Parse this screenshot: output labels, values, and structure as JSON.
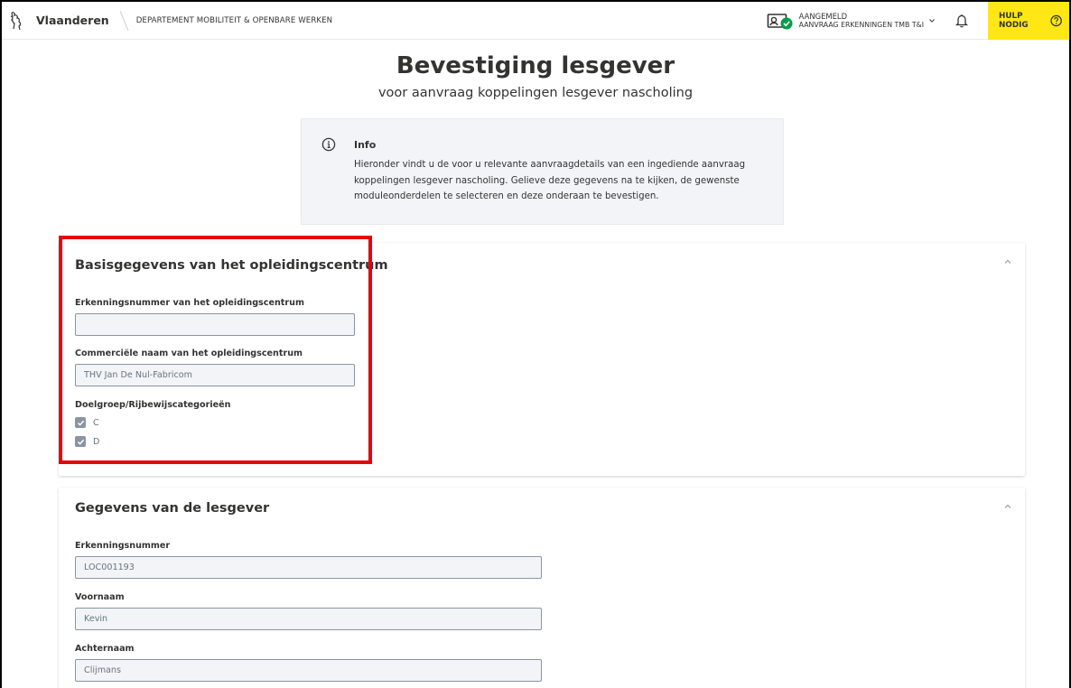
{
  "header": {
    "brand": "Vlaanderen",
    "department": "DEPARTEMENT MOBILITEIT & OPENBARE WERKEN",
    "user_status": "AANGEMELD",
    "user_role": "AANVRAAG ERKENNINGEN TMB T&I",
    "help_label": "HULP NODIG"
  },
  "page": {
    "title": "Bevestiging lesgever",
    "subtitle": "voor aanvraag koppelingen lesgever nascholing"
  },
  "info": {
    "title": "Info",
    "text": "Hieronder vindt u de voor u relevante aanvraagdetails van een ingediende aanvraag koppelingen lesgever nascholing. Gelieve deze gegevens na te kijken, de gewenste moduleonderdelen te selecteren en deze onderaan te bevestigen."
  },
  "section1": {
    "title": "Basisgegevens van het opleidingscentrum",
    "erkenningsnummer_label": "Erkenningsnummer van het opleidingscentrum",
    "erkenningsnummer_value": "",
    "commerciele_naam_label": "Commerciële naam van het opleidingscentrum",
    "commerciele_naam_value": "THV Jan De Nul-Fabricom",
    "doelgroep_label": "Doelgroep/Rijbewijscategorieën",
    "categories": [
      {
        "label": "C",
        "checked": true
      },
      {
        "label": "D",
        "checked": true
      }
    ]
  },
  "section2": {
    "title": "Gegevens van de lesgever",
    "erkenningsnummer_label": "Erkenningsnummer",
    "erkenningsnummer_value": "LOC001193",
    "voornaam_label": "Voornaam",
    "voornaam_value": "Kevin",
    "achternaam_label": "Achternaam",
    "achternaam_value": "Clijmans"
  },
  "colors": {
    "accent_yellow": "#ffe615",
    "highlight_red": "#e8000b",
    "check_green": "#009e47"
  }
}
